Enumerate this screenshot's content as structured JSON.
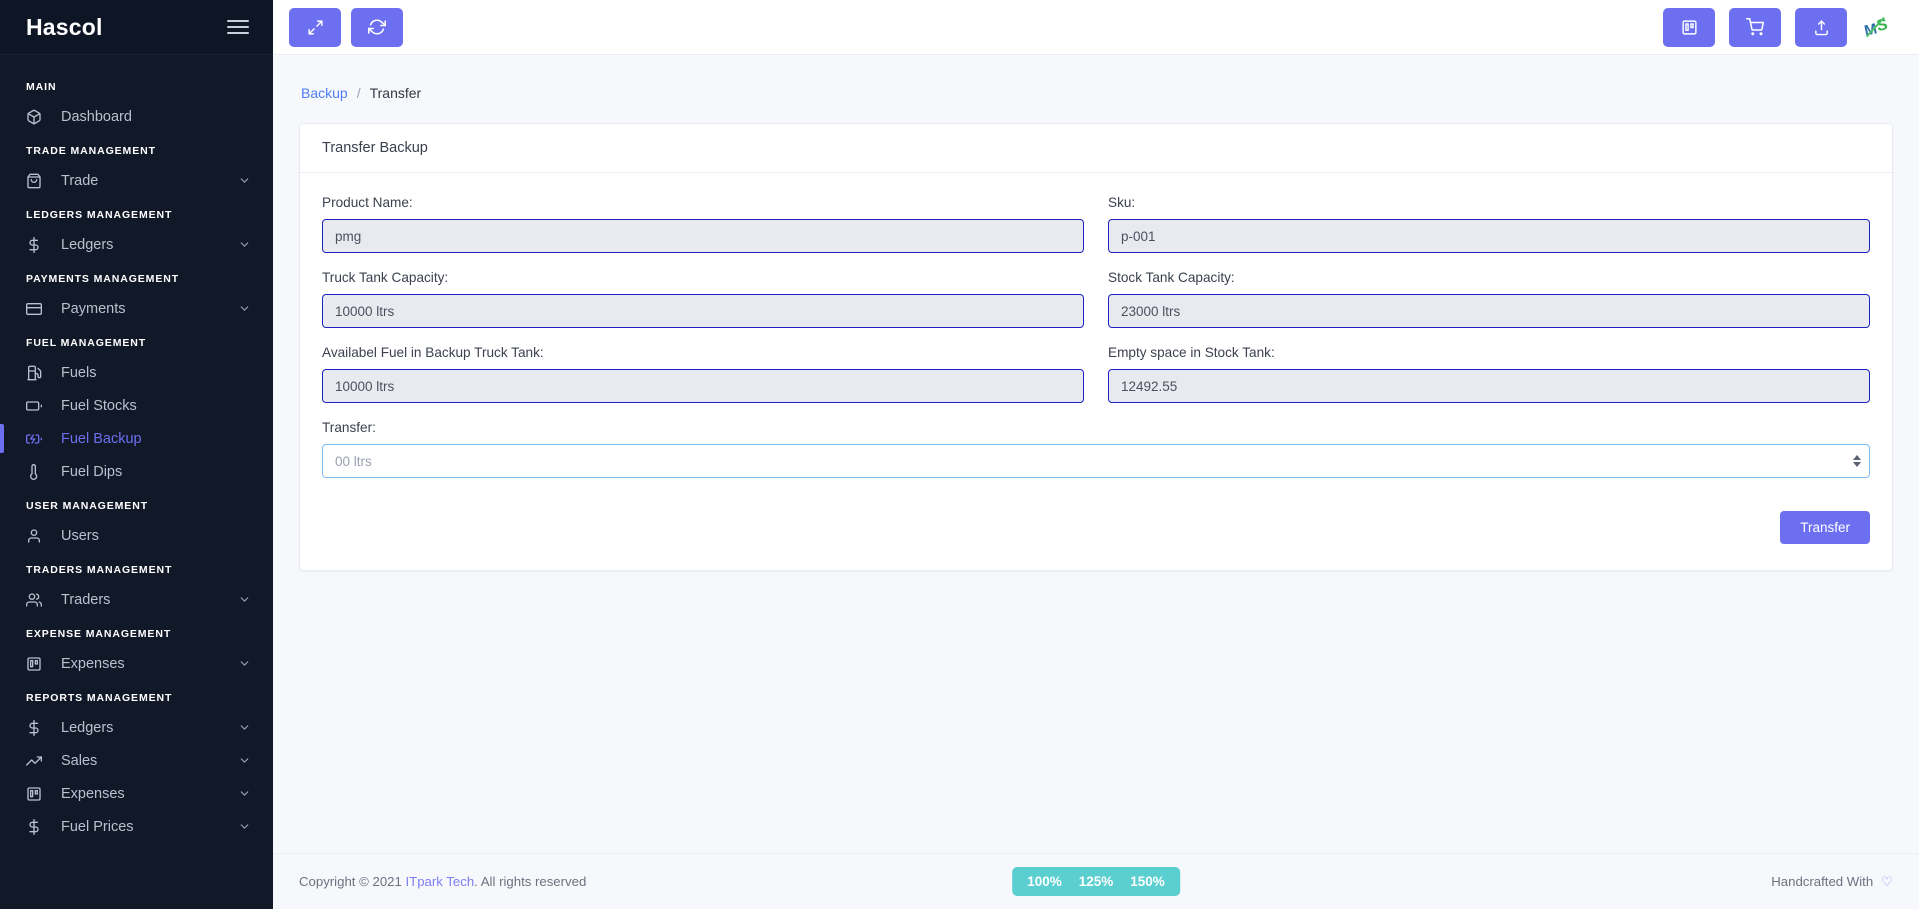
{
  "sidebar": {
    "brand": "Hascol",
    "menu_icon": "hamburger-icon",
    "groups": [
      {
        "title": "MAIN",
        "items": [
          {
            "label": "Dashboard",
            "icon": "box-icon",
            "caret": false,
            "active": false
          }
        ]
      },
      {
        "title": "TRADE MANAGEMENT",
        "items": [
          {
            "label": "Trade",
            "icon": "bag-icon",
            "caret": true,
            "active": false
          }
        ]
      },
      {
        "title": "LEDGERS MANAGEMENT",
        "items": [
          {
            "label": "Ledgers",
            "icon": "dollar-icon",
            "caret": true,
            "active": false
          }
        ]
      },
      {
        "title": "PAYMENTS MANAGEMENT",
        "items": [
          {
            "label": "Payments",
            "icon": "card-icon",
            "caret": true,
            "active": false
          }
        ]
      },
      {
        "title": "FUEL MANAGEMENT",
        "items": [
          {
            "label": "Fuels",
            "icon": "fuel-pump-icon",
            "caret": false,
            "active": false
          },
          {
            "label": "Fuel Stocks",
            "icon": "battery-icon",
            "caret": false,
            "active": false
          },
          {
            "label": "Fuel Backup",
            "icon": "battery-charging-icon",
            "caret": false,
            "active": true
          },
          {
            "label": "Fuel Dips",
            "icon": "thermometer-icon",
            "caret": false,
            "active": false
          }
        ]
      },
      {
        "title": "USER MANAGEMENT",
        "items": [
          {
            "label": "Users",
            "icon": "user-icon",
            "caret": false,
            "active": false
          }
        ]
      },
      {
        "title": "TRADERS MANAGEMENT",
        "items": [
          {
            "label": "Traders",
            "icon": "users-icon",
            "caret": true,
            "active": false
          }
        ]
      },
      {
        "title": "EXPENSE MANAGEMENT",
        "items": [
          {
            "label": "Expenses",
            "icon": "trello-icon",
            "caret": true,
            "active": false
          }
        ]
      },
      {
        "title": "REPORTS MANAGEMENT",
        "items": [
          {
            "label": "Ledgers",
            "icon": "dollar-icon",
            "caret": true,
            "active": false
          },
          {
            "label": "Sales",
            "icon": "trending-up-icon",
            "caret": true,
            "active": false
          },
          {
            "label": "Expenses",
            "icon": "trello-icon",
            "caret": true,
            "active": false
          },
          {
            "label": "Fuel Prices",
            "icon": "dollar-icon",
            "caret": true,
            "active": false
          }
        ]
      }
    ]
  },
  "topbar": {
    "left_buttons": [
      {
        "name": "fullscreen-button",
        "icon": "maximize-icon"
      },
      {
        "name": "refresh-button",
        "icon": "refresh-icon"
      }
    ],
    "right_buttons": [
      {
        "name": "expenses-button",
        "icon": "trello-icon"
      },
      {
        "name": "cart-button",
        "icon": "shopping-cart-icon"
      },
      {
        "name": "upload-button",
        "icon": "upload-icon"
      }
    ],
    "logo_text": "MS"
  },
  "breadcrumb": {
    "parent": "Backup",
    "separator": "/",
    "current": "Transfer"
  },
  "card": {
    "title": "Transfer Backup",
    "fields": [
      {
        "label": "Product Name:",
        "value": "pmg",
        "name": "product-name-field",
        "readonly": true
      },
      {
        "label": "Sku:",
        "value": "p-001",
        "name": "sku-field",
        "readonly": true
      },
      {
        "label": "Truck Tank Capacity:",
        "value": "10000 ltrs",
        "name": "truck-tank-capacity-field",
        "readonly": true
      },
      {
        "label": "Stock Tank Capacity:",
        "value": "23000 ltrs",
        "name": "stock-tank-capacity-field",
        "readonly": true
      },
      {
        "label": "Availabel Fuel in Backup Truck Tank:",
        "value": "10000 ltrs",
        "name": "available-fuel-backup-truck-tank-field",
        "readonly": true
      },
      {
        "label": "Empty space in Stock Tank:",
        "value": "12492.55",
        "name": "empty-space-stock-tank-field",
        "readonly": true
      }
    ],
    "transfer_field": {
      "label": "Transfer:",
      "value": "",
      "placeholder": "00 ltrs"
    },
    "submit_label": "Transfer"
  },
  "footer": {
    "copyright_prefix": "Copyright © 2021 ",
    "company": "ITpark Tech",
    "copyright_suffix": ". All rights reserved",
    "zoom_levels": [
      "100%",
      "125%",
      "150%"
    ],
    "handcrafted_text": "Handcrafted With",
    "heart": "♡"
  },
  "colors": {
    "accent": "#6c70f0",
    "sidebar_bg": "#111827",
    "link": "#4f7df3",
    "teal": "#5bcfd0",
    "input_border": "#1e22c4"
  }
}
